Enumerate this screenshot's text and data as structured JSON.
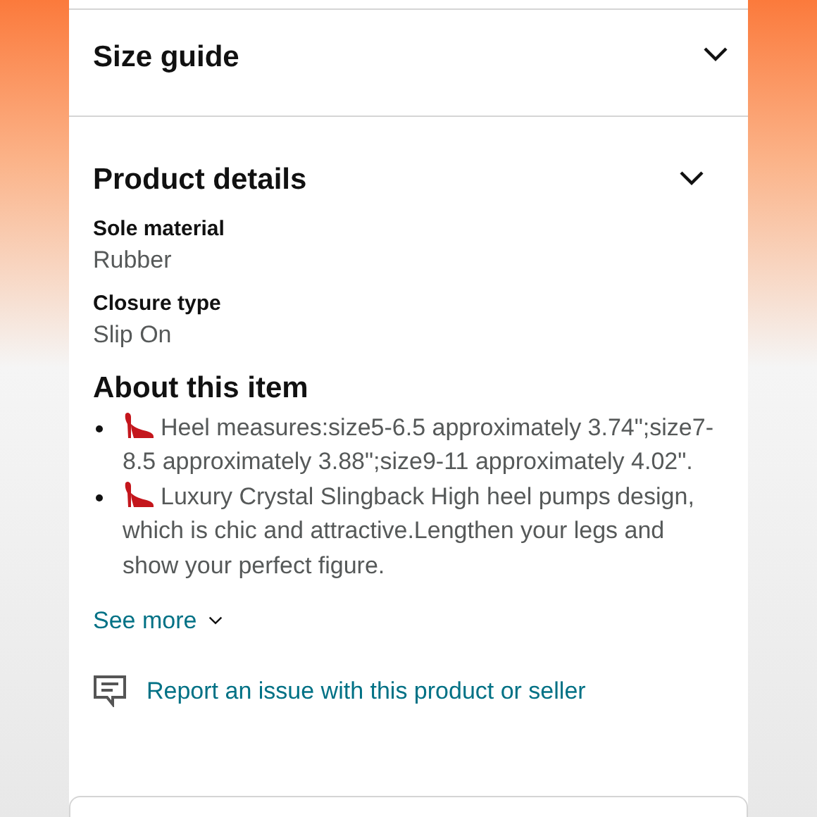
{
  "sections": [
    {
      "title": "Size guide"
    },
    {
      "title": "Product details",
      "attributes": [
        {
          "label": "Sole material",
          "value": "Rubber"
        },
        {
          "label": "Closure type",
          "value": "Slip On"
        }
      ]
    }
  ],
  "about": {
    "title": "About this item",
    "bullets": [
      "Heel measures:size5-6.5 approximately 3.74\";size7-8.5 approximately 3.88\";size9-11 approximately 4.02\".",
      "Luxury Crystal Slingback High heel pumps design, which is chic and attractive.Lengthen your legs and show your perfect figure."
    ],
    "see_more": "See more"
  },
  "report_link": "Report an issue with this product or seller"
}
